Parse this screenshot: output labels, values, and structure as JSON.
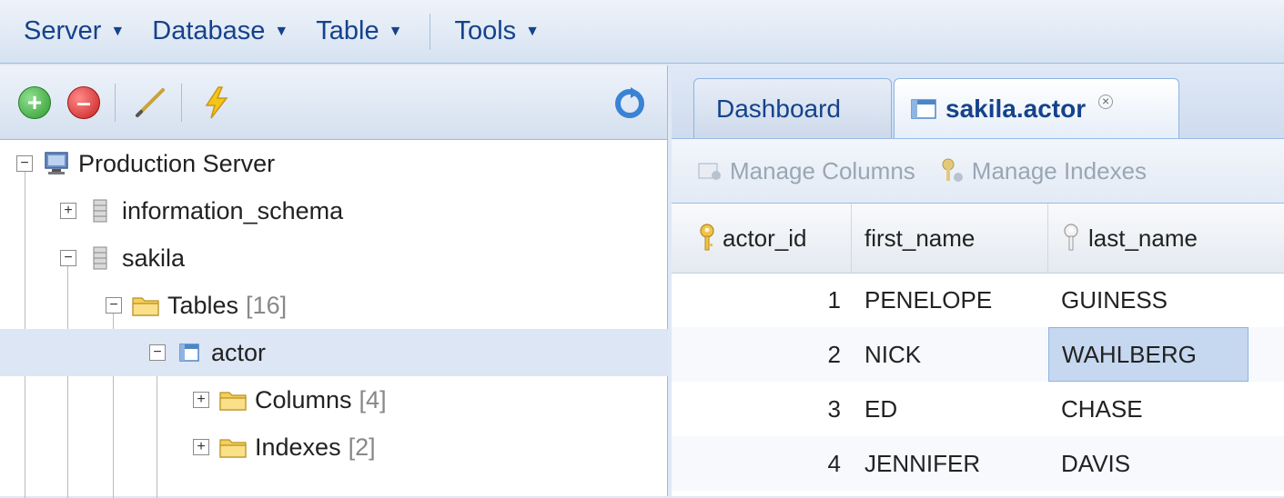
{
  "menubar": {
    "items": [
      {
        "label": "Server"
      },
      {
        "label": "Database"
      },
      {
        "label": "Table"
      },
      {
        "label": "Tools"
      }
    ]
  },
  "tree": {
    "server": {
      "label": "Production Server"
    },
    "db1": {
      "label": "information_schema"
    },
    "db2": {
      "label": "sakila"
    },
    "tables": {
      "label": "Tables",
      "count": "[16]"
    },
    "actor": {
      "label": "actor"
    },
    "columns": {
      "label": "Columns",
      "count": "[4]"
    },
    "indexes": {
      "label": "Indexes",
      "count": "[2]"
    }
  },
  "tabs": {
    "dashboard": "Dashboard",
    "active": "sakila.actor"
  },
  "subtoolbar": {
    "manage_columns": "Manage Columns",
    "manage_indexes": "Manage Indexes"
  },
  "grid": {
    "columns": [
      "actor_id",
      "first_name",
      "last_name"
    ],
    "rows": [
      {
        "actor_id": "1",
        "first_name": "PENELOPE",
        "last_name": "GUINESS"
      },
      {
        "actor_id": "2",
        "first_name": "NICK",
        "last_name": "WAHLBERG"
      },
      {
        "actor_id": "3",
        "first_name": "ED",
        "last_name": "CHASE"
      },
      {
        "actor_id": "4",
        "first_name": "JENNIFER",
        "last_name": "DAVIS"
      }
    ]
  },
  "icons": {
    "add": "add-circle-icon",
    "remove": "remove-circle-icon",
    "edit": "pencil-icon",
    "execute": "lightning-icon",
    "refresh": "refresh-icon"
  },
  "colors": {
    "accent": "#15428b",
    "selection": "#c6d8f0"
  }
}
